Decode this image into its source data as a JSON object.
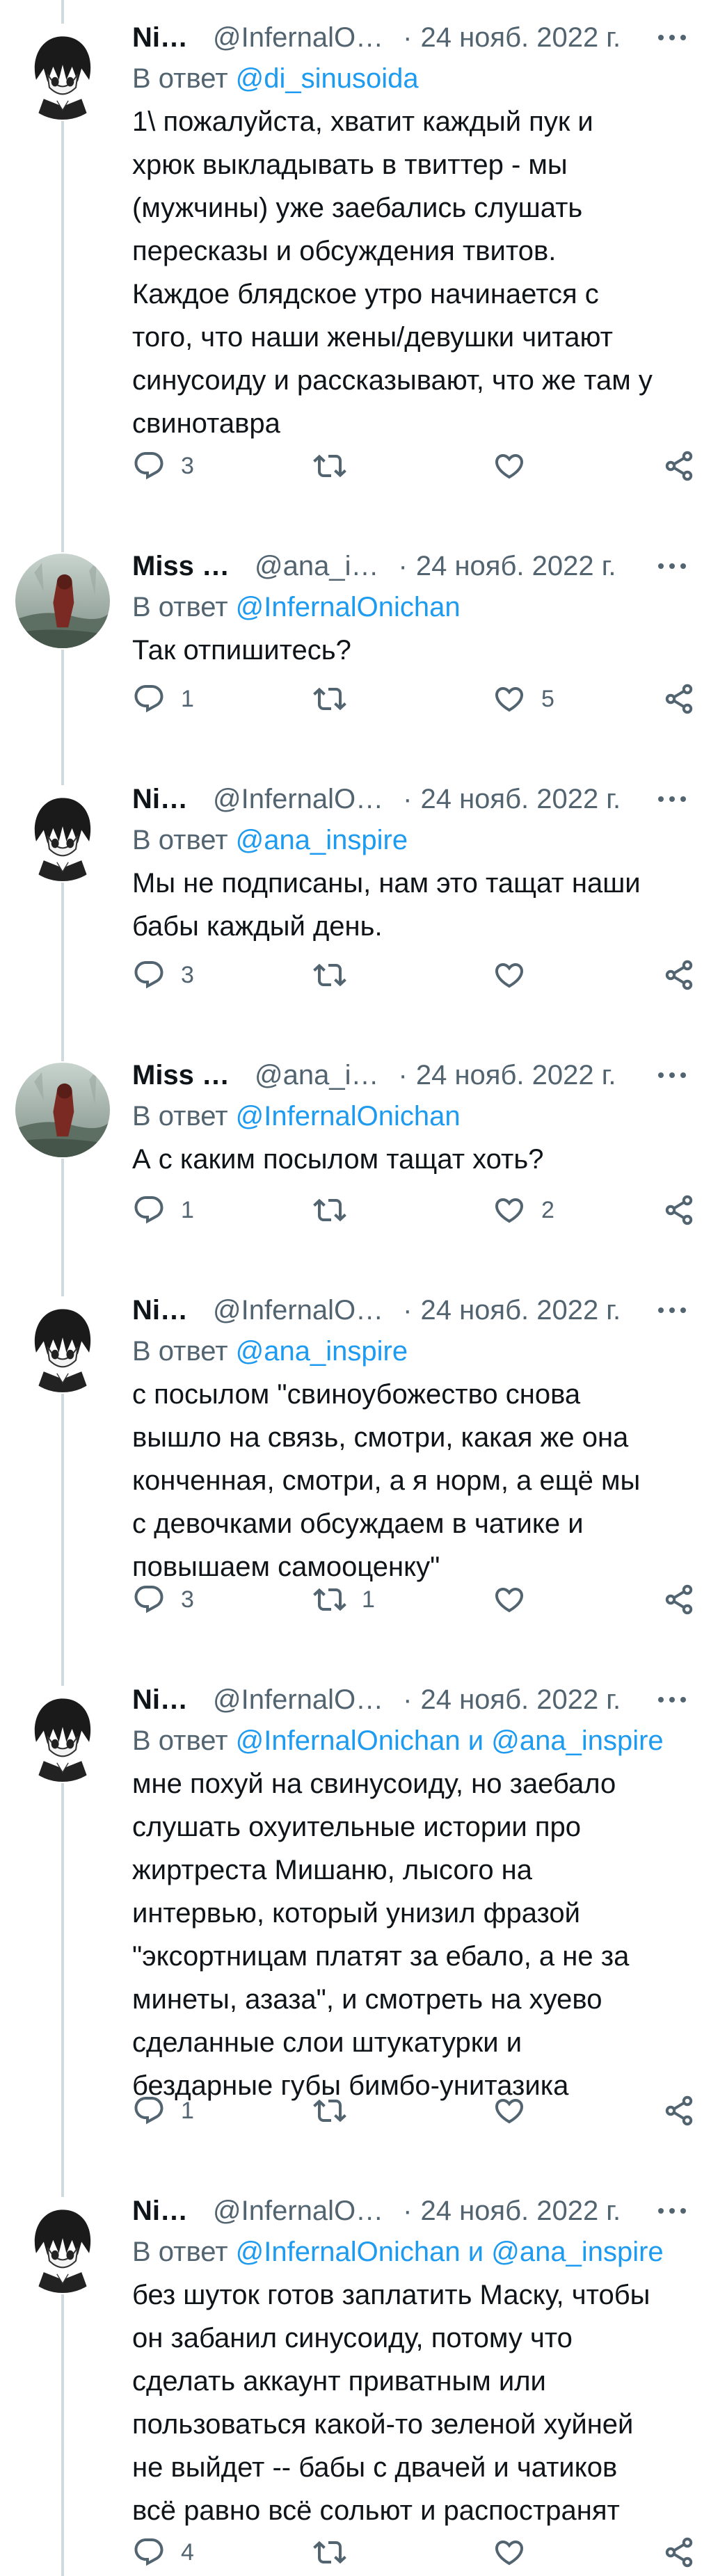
{
  "reply_prefix": "В ответ",
  "reply_joiner": "и",
  "tweets": [
    {
      "name": "Ni…",
      "handle": "@InfernalO…",
      "sep": "·",
      "date": "24 нояб. 2022 г.",
      "reply_to": [
        "@di_sinusoida"
      ],
      "text": "1\\ пожалуйста, хватит каждый пук и\nхрюк выкладывать в твиттер - мы\n(мужчины) уже заебались слушать\nпересказы и обсуждения твитов.\nКаждое блядское утро начинается с\nтого, что наши жены/девушки читают\nсинусоиду и рассказывают, что же там у\nсвинотавра",
      "replies": "3",
      "retweets": "",
      "likes": "",
      "avatar": "anime-boy"
    },
    {
      "name": "Miss …",
      "handle": "@ana_i…",
      "sep": "·",
      "date": "24 нояб. 2022 г.",
      "reply_to": [
        "@InfernalOnichan"
      ],
      "text": "Так отпишитесь?",
      "replies": "1",
      "retweets": "",
      "likes": "5",
      "avatar": "woman-photo"
    },
    {
      "name": "Ni…",
      "handle": "@InfernalO…",
      "sep": "·",
      "date": "24 нояб. 2022 г.",
      "reply_to": [
        "@ana_inspire"
      ],
      "text": "Мы не подписаны, нам это тащат наши\nбабы каждый день.",
      "replies": "3",
      "retweets": "",
      "likes": "",
      "avatar": "anime-boy"
    },
    {
      "name": "Miss …",
      "handle": "@ana_i…",
      "sep": "·",
      "date": "24 нояб. 2022 г.",
      "reply_to": [
        "@InfernalOnichan"
      ],
      "text": "А с каким посылом тащат хоть?",
      "replies": "1",
      "retweets": "",
      "likes": "2",
      "avatar": "woman-photo"
    },
    {
      "name": "Ni…",
      "handle": "@InfernalO…",
      "sep": "·",
      "date": "24 нояб. 2022 г.",
      "reply_to": [
        "@ana_inspire"
      ],
      "text": "с посылом \"свиноубожество снова\nвышло на связь, смотри, какая же она\nконченная, смотри, а я норм, а ещё мы\nс девочками обсуждаем в чатике и\nповышаем самооценку\"",
      "replies": "3",
      "retweets": "1",
      "likes": "",
      "avatar": "anime-boy"
    },
    {
      "name": "Ni…",
      "handle": "@InfernalO…",
      "sep": "·",
      "date": "24 нояб. 2022 г.",
      "reply_to": [
        "@InfernalOnichan",
        "@ana_inspire"
      ],
      "text": "мне похуй на свинусоиду, но заебало\nслушать охуительные истории про\nжиртреста Мишаню, лысого на\nинтервью, который унизил фразой\n\"эксортницам платят за ебало, а не за\nминеты, азаза\", и смотреть на хуево\nсделанные слои штукатурки и\nбездарные губы бимбо-унитазика",
      "replies": "1",
      "retweets": "",
      "likes": "",
      "avatar": "anime-boy"
    },
    {
      "name": "Ni…",
      "handle": "@InfernalO…",
      "sep": "·",
      "date": "24 нояб. 2022 г.",
      "reply_to": [
        "@InfernalOnichan",
        "@ana_inspire"
      ],
      "text": "без шуток готов заплатить Маску, чтобы\nон забанил синусоиду, потому что\nсделать аккаунт приватным или\nпользоваться какой-то зеленой хуйней\nне выйдет -- бабы с двачей и чатиков\nвсё равно всё сольют и распостранят",
      "replies": "4",
      "retweets": "",
      "likes": "",
      "avatar": "anime-boy"
    }
  ]
}
